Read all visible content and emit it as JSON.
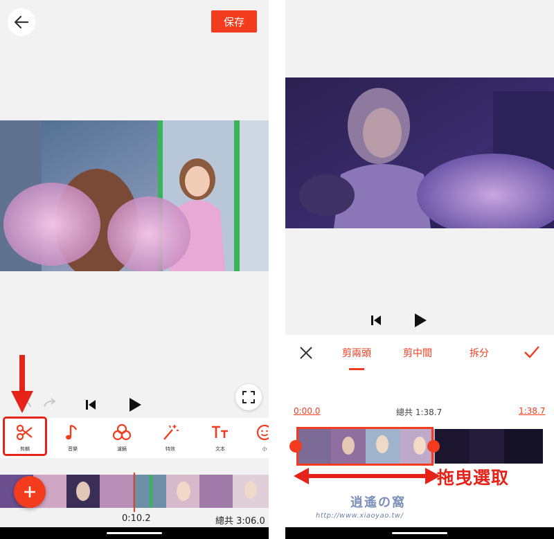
{
  "left_screen": {
    "save_label": "保存",
    "toolbar": [
      {
        "label": "剪輯",
        "icon": "scissors-icon"
      },
      {
        "label": "音樂",
        "icon": "music-note-icon"
      },
      {
        "label": "濾鏡",
        "icon": "filter-circles-icon"
      },
      {
        "label": "特效",
        "icon": "magic-wand-icon"
      },
      {
        "label": "文本",
        "icon": "text-icon"
      },
      {
        "label": "小",
        "icon": "sticker-face-icon"
      }
    ],
    "current_time": "0:10.2",
    "total_time": "總共 3:06.0"
  },
  "right_screen": {
    "tabs": [
      {
        "label": "剪兩頭",
        "active": true
      },
      {
        "label": "剪中間",
        "active": false
      },
      {
        "label": "拆分",
        "active": false
      }
    ],
    "range_start": "0:00.0",
    "range_total": "總共 1:38.7",
    "range_end": "1:38.7",
    "annotation_label": "拖曳選取"
  },
  "watermark": {
    "main": "逍遙の窩",
    "url": "http://www.xiaoyao.tw/"
  },
  "colors": {
    "accent": "#f23c1d",
    "annotation_red": "#e52318",
    "background": "#f2f2f2"
  }
}
